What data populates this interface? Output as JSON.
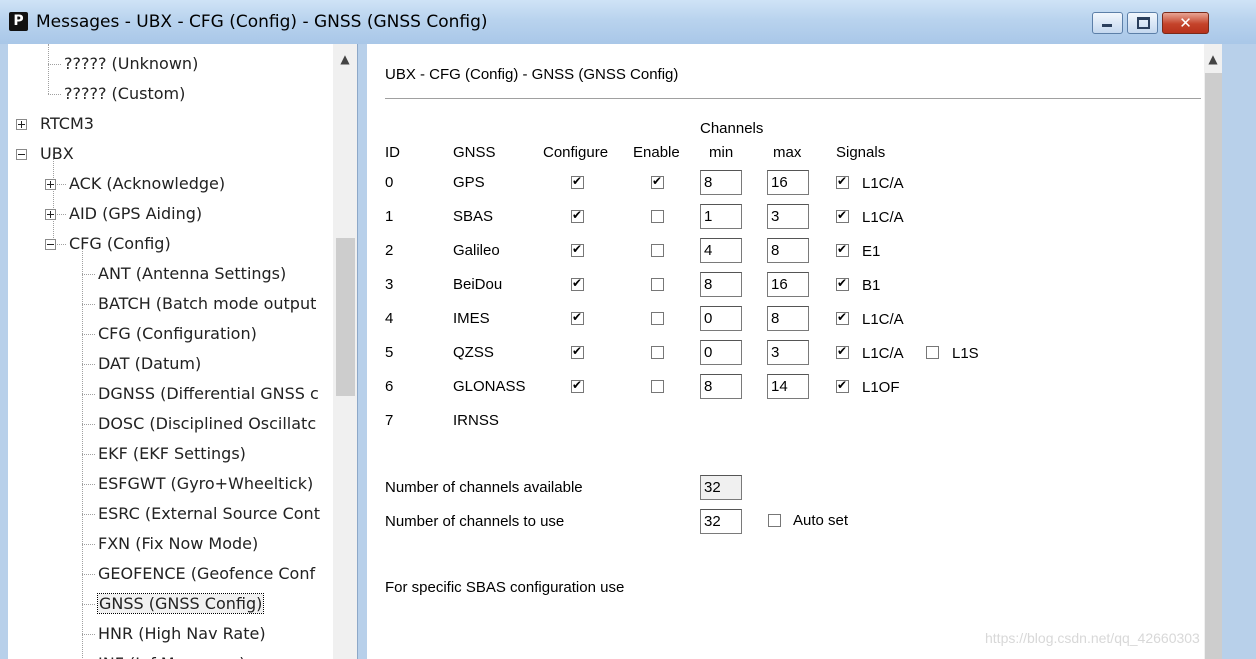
{
  "window": {
    "app_icon": "P",
    "title": "Messages - UBX - CFG (Config) - GNSS (GNSS Config)",
    "controls": {
      "minimize": "minimize-icon",
      "maximize": "maximize-icon",
      "close": "close-icon"
    }
  },
  "tree": {
    "items": [
      {
        "label": "????? (Unknown)"
      },
      {
        "label": "????? (Custom)"
      },
      {
        "label": "RTCM3"
      },
      {
        "label": "UBX"
      },
      {
        "label": "ACK (Acknowledge)"
      },
      {
        "label": "AID (GPS Aiding)"
      },
      {
        "label": "CFG (Config)"
      },
      {
        "label": "ANT (Antenna Settings)"
      },
      {
        "label": "BATCH (Batch mode output"
      },
      {
        "label": "CFG (Configuration)"
      },
      {
        "label": "DAT (Datum)"
      },
      {
        "label": "DGNSS (Differential GNSS c"
      },
      {
        "label": "DOSC (Disciplined Oscillatc"
      },
      {
        "label": "EKF (EKF Settings)"
      },
      {
        "label": "ESFGWT (Gyro+Wheeltick)"
      },
      {
        "label": "ESRC (External Source Cont"
      },
      {
        "label": "FXN (Fix Now Mode)"
      },
      {
        "label": "GEOFENCE (Geofence Conf"
      },
      {
        "label": "GNSS (GNSS Config)"
      },
      {
        "label": "HNR (High Nav Rate)"
      },
      {
        "label": "INF (Inf Messages)"
      }
    ]
  },
  "panel": {
    "header": "UBX - CFG (Config) - GNSS (GNSS Config)",
    "columns": {
      "id": "ID",
      "gnss": "GNSS",
      "configure": "Configure",
      "enable": "Enable",
      "channels": "Channels",
      "min": "min",
      "max": "max",
      "signals": "Signals"
    },
    "rows": [
      {
        "id": "0",
        "gnss": "GPS",
        "configure": true,
        "enable": true,
        "min": "8",
        "max": "16",
        "signals": [
          {
            "label": "L1C/A",
            "checked": true
          }
        ]
      },
      {
        "id": "1",
        "gnss": "SBAS",
        "configure": true,
        "enable": false,
        "min": "1",
        "max": "3",
        "signals": [
          {
            "label": "L1C/A",
            "checked": true
          }
        ]
      },
      {
        "id": "2",
        "gnss": "Galileo",
        "configure": true,
        "enable": false,
        "min": "4",
        "max": "8",
        "signals": [
          {
            "label": "E1",
            "checked": true
          }
        ]
      },
      {
        "id": "3",
        "gnss": "BeiDou",
        "configure": true,
        "enable": false,
        "min": "8",
        "max": "16",
        "signals": [
          {
            "label": "B1",
            "checked": true
          }
        ]
      },
      {
        "id": "4",
        "gnss": "IMES",
        "configure": true,
        "enable": false,
        "min": "0",
        "max": "8",
        "signals": [
          {
            "label": "L1C/A",
            "checked": true
          }
        ]
      },
      {
        "id": "5",
        "gnss": "QZSS",
        "configure": true,
        "enable": false,
        "min": "0",
        "max": "3",
        "signals": [
          {
            "label": "L1C/A",
            "checked": true
          },
          {
            "label": "L1S",
            "checked": false
          }
        ]
      },
      {
        "id": "6",
        "gnss": "GLONASS",
        "configure": true,
        "enable": false,
        "min": "8",
        "max": "14",
        "signals": [
          {
            "label": "L1OF",
            "checked": true
          }
        ]
      },
      {
        "id": "7",
        "gnss": "IRNSS"
      }
    ],
    "channels_available": {
      "label": "Number of channels available",
      "value": "32"
    },
    "channels_to_use": {
      "label": "Number of channels to use",
      "value": "32"
    },
    "auto_set": {
      "label": "Auto set",
      "checked": false
    },
    "sbas_note": "For specific SBAS configuration use"
  },
  "watermark": "https://blog.csdn.net/qq_42660303"
}
